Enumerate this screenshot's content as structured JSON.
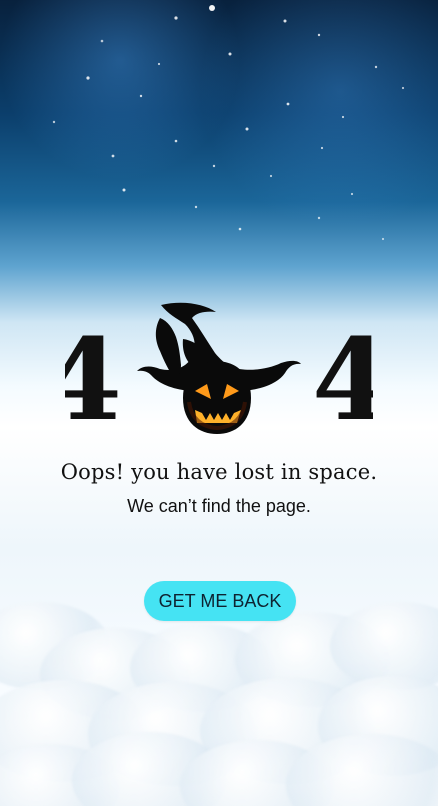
{
  "hero": {
    "left_digit": "4",
    "right_digit": "4"
  },
  "message": {
    "headline": "Oops! you have lost in space.",
    "subline": "We can’t find the page."
  },
  "actions": {
    "back_label": "GET ME BACK"
  },
  "icons": {
    "center_icon": "witch-hat-pumpkin-icon"
  },
  "colors": {
    "button_bg": "#45e3f3",
    "text": "#111111",
    "pumpkin_glow": "#ff9a1a"
  }
}
